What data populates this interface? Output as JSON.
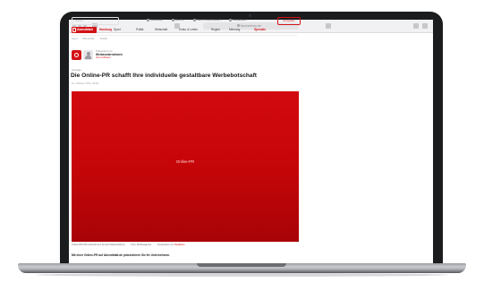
{
  "browser": {
    "url": "fischerfrey.de"
  },
  "site": {
    "search_placeholder": "Suche",
    "utility_links": [
      "Newsletter",
      "Events",
      "Mein Kundenbereich",
      "Mediadaten"
    ],
    "login_label": "Anmelden",
    "logo_text": "Abendblatt",
    "nav_items": [
      "Hamburg",
      "Sport",
      "Politik",
      "Wirtschaft",
      "Kultur & Leben",
      "Region",
      "Meinung",
      "Specials"
    ],
    "nav_highlight": "Specials",
    "subnav_items": [
      "Sport",
      "Wirtschaft",
      "Politik"
    ]
  },
  "article": {
    "author_kicker": "Präsentiert von",
    "author_name": "Werbeunternehmen",
    "author_link": "Zum Anbieter",
    "kicker": "Anzeige",
    "headline": "Die Online-PR schafft Ihre individuelle gestaltbare Werbebotschaft",
    "dateline": "12. Oktober 2023, 09:00",
    "hero_text": "Online-PR",
    "caption_left": "Online-PR hilft Unternehmen bei der Markenbildung",
    "caption_right": "Foto: Werbeagentur",
    "caption_credit_prefix": "Fotografiert von",
    "caption_credit_name": "Redaktion",
    "body_first_line": "Mit einer Online-PR auf Abendblatt.de präsentieren Sie Ihr Unternehmen."
  },
  "colors": {
    "brand_red": "#d31217",
    "hero_top": "#d10a0f",
    "hero_bottom": "#a80307"
  }
}
